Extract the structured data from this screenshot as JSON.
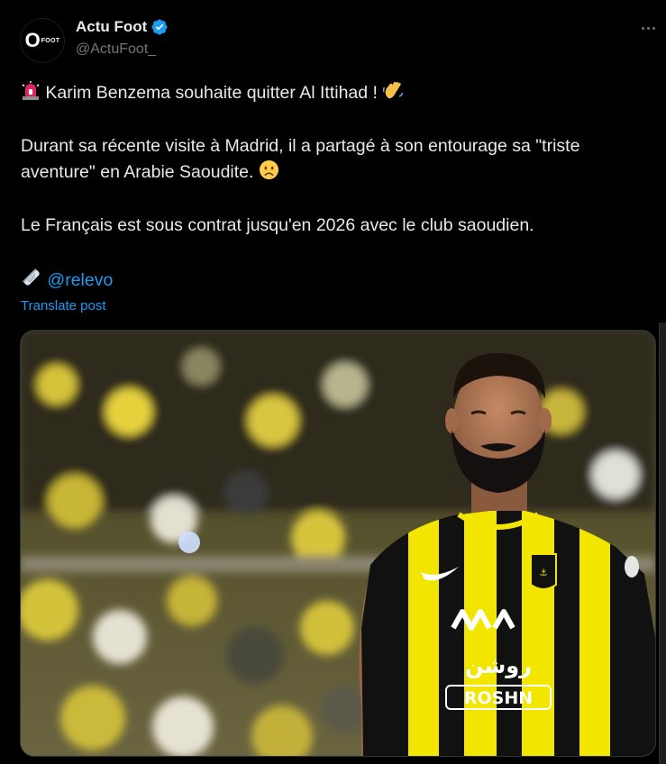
{
  "account": {
    "display_name": "Actu Foot",
    "handle": "@ActuFoot_",
    "avatar_text_big": "O",
    "avatar_text_small": "FOOT",
    "verified_color": "#1d9bf0"
  },
  "post": {
    "line1": "Karim Benzema souhaite quitter Al Ittihad !",
    "line2": "Durant sa récente visite à Madrid, il a partagé à son entourage sa \"triste aventure\" en Arabie Saoudite.",
    "line3": "Le Français est sous contrat jusqu'en 2026 avec le club saoudien.",
    "mention": "@relevo",
    "translate_label": "Translate post"
  },
  "media": {
    "jersey_sponsor_arabic": "روشن",
    "jersey_sponsor": "ROSHN",
    "colors": {
      "accent": "#1d9bf0",
      "stripe_yellow": "#f2e600",
      "jersey_black": "#111111"
    }
  },
  "icons": {
    "siren": "siren-icon",
    "wave": "waving-hand-icon",
    "sad": "sad-face-icon",
    "newspaper": "rolled-newspaper-icon",
    "more": "more-options-icon",
    "verified": "verified-badge-icon"
  }
}
